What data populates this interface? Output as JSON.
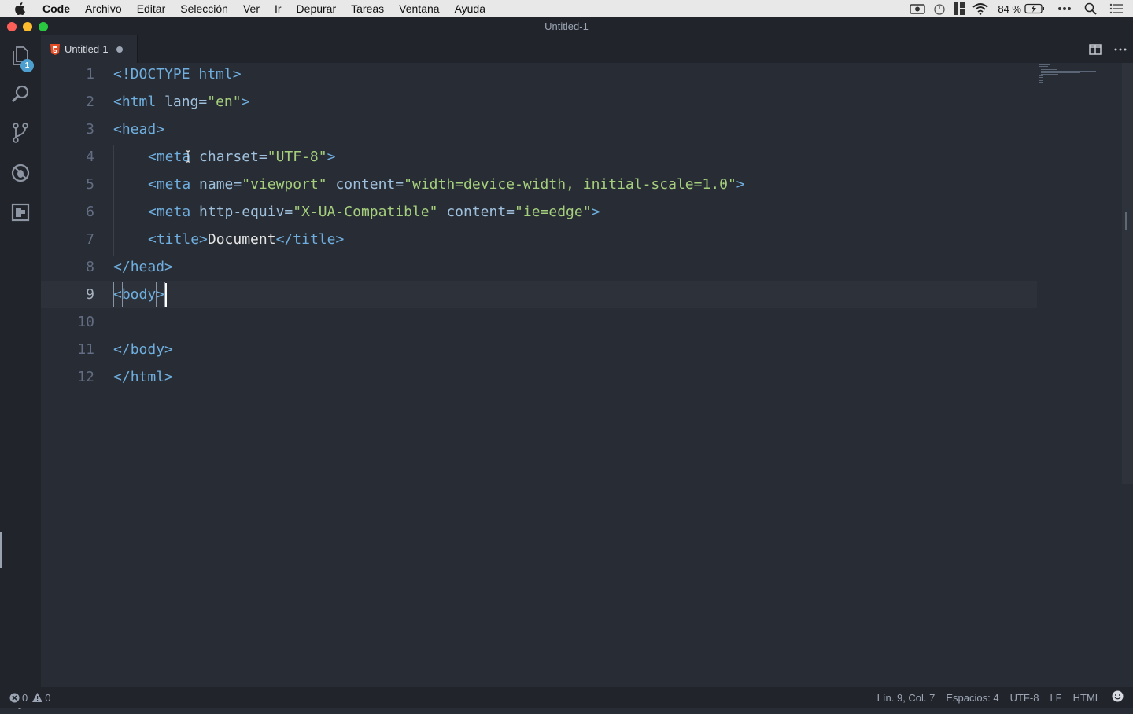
{
  "menubar": {
    "app": "Code",
    "items": [
      "Archivo",
      "Editar",
      "Selección",
      "Ver",
      "Ir",
      "Depurar",
      "Tareas",
      "Ventana",
      "Ayuda"
    ],
    "battery": "84 %",
    "icons": [
      "screen-record-icon",
      "timer-icon",
      "layout-icon",
      "wifi-icon",
      "battery-icon",
      "more-icon",
      "spotlight-icon",
      "notification-list-icon"
    ]
  },
  "window": {
    "title": "Untitled-1"
  },
  "activitybar": {
    "items": [
      "explorer-icon",
      "search-icon",
      "source-control-icon",
      "debug-icon",
      "extensions-icon"
    ],
    "explorer_badge": "1"
  },
  "tab": {
    "label": "Untitled-1",
    "icon": "html5-icon",
    "dirty": true
  },
  "editor": {
    "language": "html",
    "lines": [
      {
        "n": "1"
      },
      {
        "n": "2"
      },
      {
        "n": "3"
      },
      {
        "n": "4"
      },
      {
        "n": "5"
      },
      {
        "n": "6"
      },
      {
        "n": "7"
      },
      {
        "n": "8"
      },
      {
        "n": "9"
      },
      {
        "n": "10"
      },
      {
        "n": "11"
      },
      {
        "n": "12"
      }
    ],
    "code": {
      "l1": {
        "open": "<!",
        "kw": "DOCTYPE html",
        "close": ">"
      },
      "l2": {
        "open": "<",
        "tag": "html",
        "attr": " lang=",
        "str": "\"en\"",
        "close": ">"
      },
      "l3": {
        "open": "<",
        "tag": "head",
        "close": ">"
      },
      "l4": {
        "open": "<",
        "tag": "meta",
        "attr": " charset=",
        "str": "\"UTF-8\"",
        "close": ">"
      },
      "l5": {
        "open": "<",
        "tag": "meta",
        "attr1": " name=",
        "str1": "\"viewport\"",
        "attr2": " content=",
        "str2": "\"width=device-width, initial-scale=1.0\"",
        "close": ">"
      },
      "l6": {
        "open": "<",
        "tag": "meta",
        "attr1": " http-equiv=",
        "str1": "\"X-UA-Compatible\"",
        "attr2": " content=",
        "str2": "\"ie=edge\"",
        "close": ">"
      },
      "l7": {
        "open": "<",
        "tag": "title",
        "close": ">",
        "text": "Document",
        "open2": "</",
        "tag2": "title",
        "close2": ">"
      },
      "l8": {
        "open": "</",
        "tag": "head",
        "close": ">"
      },
      "l9": {
        "open": "<",
        "tag": "body",
        "close": ">"
      },
      "l11": {
        "open": "</",
        "tag": "body",
        "close": ">"
      },
      "l12": {
        "open": "</",
        "tag": "html",
        "close": ">"
      }
    }
  },
  "statusbar": {
    "errors": "0",
    "warnings": "0",
    "position": "Lín. 9, Col. 7",
    "indent": "Espacios: 4",
    "encoding": "UTF-8",
    "eol": "LF",
    "language": "HTML"
  },
  "colors": {
    "background": "#282c34",
    "chrome": "#21252b",
    "tag": "#6faede",
    "string": "#a5cf7d",
    "line_number": "#636d83",
    "badge": "#4d9fd0"
  }
}
